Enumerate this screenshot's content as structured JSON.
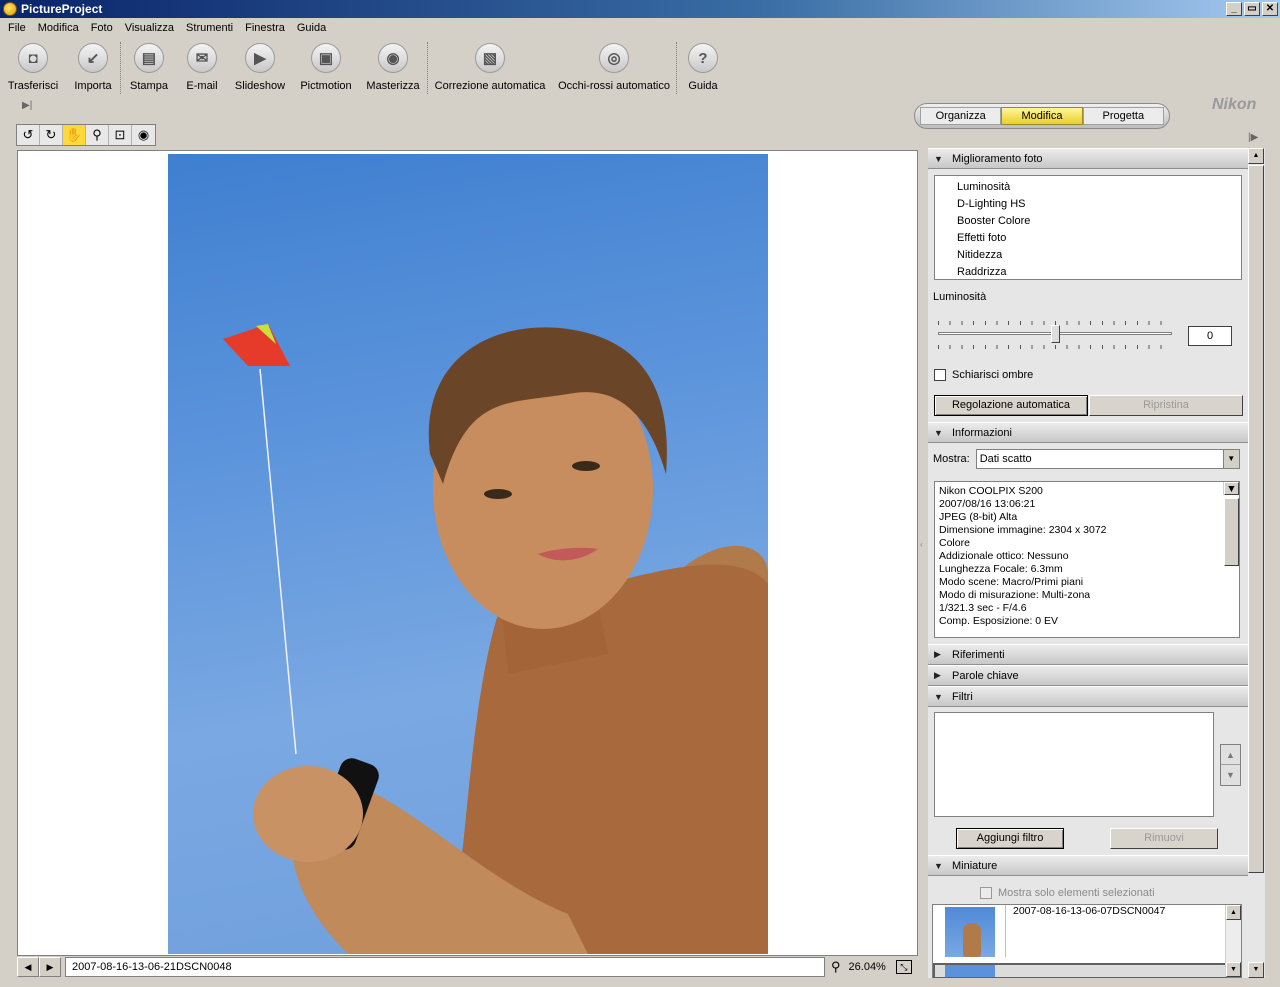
{
  "window": {
    "title": "PictureProject",
    "controls": [
      "_",
      "▭",
      "✕"
    ]
  },
  "menu": [
    "File",
    "Modifica",
    "Foto",
    "Visualizza",
    "Strumenti",
    "Finestra",
    "Guida"
  ],
  "toolbar": {
    "transfer": "Trasferisci",
    "import": "Importa",
    "print": "Stampa",
    "email": "E-mail",
    "slideshow": "Slideshow",
    "pictmotion": "Pictmotion",
    "burn": "Masterizza",
    "auto_correct": "Correzione automatica",
    "auto_redeye": "Occhi-rossi automatico",
    "help": "Guida"
  },
  "mode_tabs": [
    "Organizza",
    "Modifica",
    "Progetta"
  ],
  "active_mode": "Modifica",
  "brand": "Nikon",
  "tools": [
    "rotate-left-icon",
    "rotate-right-icon",
    "hand-icon",
    "magnifier-icon",
    "crop-icon",
    "eye-icon"
  ],
  "status": {
    "filename": "2007-08-16-13-06-21DSCN0048",
    "zoom": "26.04%"
  },
  "panel": {
    "enhance": {
      "title": "Miglioramento foto",
      "items": [
        "Luminosità",
        "D-Lighting HS",
        "Booster Colore",
        "Effetti foto",
        "Nitidezza",
        "Raddrizza"
      ],
      "brightness_label": "Luminosità",
      "brightness_value": "0",
      "brightness_level": 0.5,
      "shadow_label": "Schiarisci ombre",
      "auto_button": "Regolazione automatica",
      "reset_button": "Ripristina"
    },
    "info": {
      "title": "Informazioni",
      "show_label": "Mostra:",
      "show_value": "Dati scatto",
      "lines": [
        "Nikon COOLPIX S200",
        "2007/08/16 13:06:21",
        "JPEG (8-bit) Alta",
        "Dimensione immagine: 2304 x 3072",
        "Colore",
        "Addizionale ottico: Nessuno",
        "Lunghezza Focale: 6.3mm",
        "Modo scene: Macro/Primi piani",
        "Modo di misurazione: Multi-zona",
        "1/321.3 sec - F/4.6",
        "Comp. Esposizione: 0 EV"
      ]
    },
    "references": {
      "title": "Riferimenti"
    },
    "keywords": {
      "title": "Parole chiave"
    },
    "filters": {
      "title": "Filtri",
      "add_button": "Aggiungi filtro",
      "remove_button": "Rimuovi"
    },
    "thumbnails": {
      "title": "Miniature",
      "only_selected": "Mostra solo elementi selezionati",
      "first_label": "2007-08-16-13-06-07DSCN0047"
    }
  }
}
